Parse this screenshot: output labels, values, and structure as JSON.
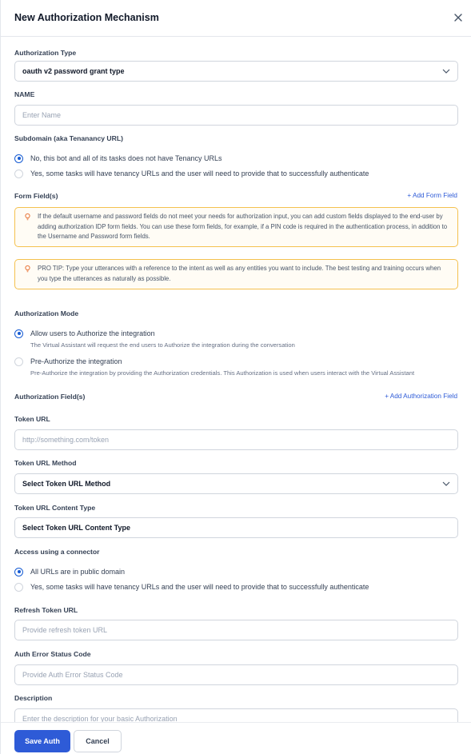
{
  "header": {
    "title": "New Authorization Mechanism",
    "close_icon": "close-icon"
  },
  "auth_type": {
    "label": "Authorization Type",
    "value": "oauth v2 password grant type"
  },
  "name": {
    "label": "NAME",
    "placeholder": "Enter Name"
  },
  "subdomain": {
    "label": "Subdomain (aka Tenanancy URL)",
    "options": [
      {
        "label": "No, this bot and all of its tasks does not have Tenancy URLs",
        "checked": true
      },
      {
        "label": "Yes, some tasks will have tenancy URLs and the user will need to provide that to successfully authenticate",
        "checked": false
      }
    ]
  },
  "form_fields": {
    "label": "Form Field(s)",
    "add_link": "+ Add Form Field",
    "note": "If the default username and password fields do not meet your needs for authorization input, you can add custom fields displayed to the end-user by adding authorization IDP form fields. You can use these form fields, for example, if a PIN code is required in the authentication process, in addition to the Username and Password form fields.",
    "tip": "PRO TIP: Type your utterances with a reference to the intent as well as any entities you want to include. The best testing and training occurs when you type the utterances as naturally as possible."
  },
  "auth_mode": {
    "label": "Authorization Mode",
    "options": [
      {
        "label": "Allow users to Authorize the integration",
        "desc": "The Virtual Assistant will request the end users to Authorize the integration during the conversation",
        "checked": true
      },
      {
        "label": "Pre-Authorize the integration",
        "desc": "Pre-Authorize the integration by providing the Authorization credentials. This Authorization is used when users interact with the Virtual Assistant",
        "checked": false
      }
    ]
  },
  "auth_fields": {
    "label": "Authorization Field(s)",
    "add_link": "+ Add Authorization Field"
  },
  "token_url": {
    "label": "Token URL",
    "placeholder": "http://something.com/token"
  },
  "token_method": {
    "label": "Token URL Method",
    "value": "Select Token URL Method"
  },
  "token_content_type": {
    "label": "Token URL Content Type",
    "value": "Select Token URL Content Type"
  },
  "connector": {
    "label": "Access using a connector",
    "options": [
      {
        "label": "All URLs are in public domain",
        "checked": true
      },
      {
        "label": "Yes, some tasks will have tenancy URLs and the user will need to provide that to successfully authenticate",
        "checked": false
      }
    ]
  },
  "refresh_token": {
    "label": "Refresh Token URL",
    "placeholder": "Provide refresh token URL"
  },
  "auth_error": {
    "label": "Auth Error Status Code",
    "placeholder": "Provide Auth Error Status Code"
  },
  "description": {
    "label": "Description",
    "placeholder": "Enter the description for your basic Authorization"
  },
  "footer": {
    "save": "Save Auth",
    "cancel": "Cancel"
  },
  "colors": {
    "accent": "#2e5bd7",
    "note_border": "#f4c14f",
    "note_icon": "#e8763a"
  }
}
